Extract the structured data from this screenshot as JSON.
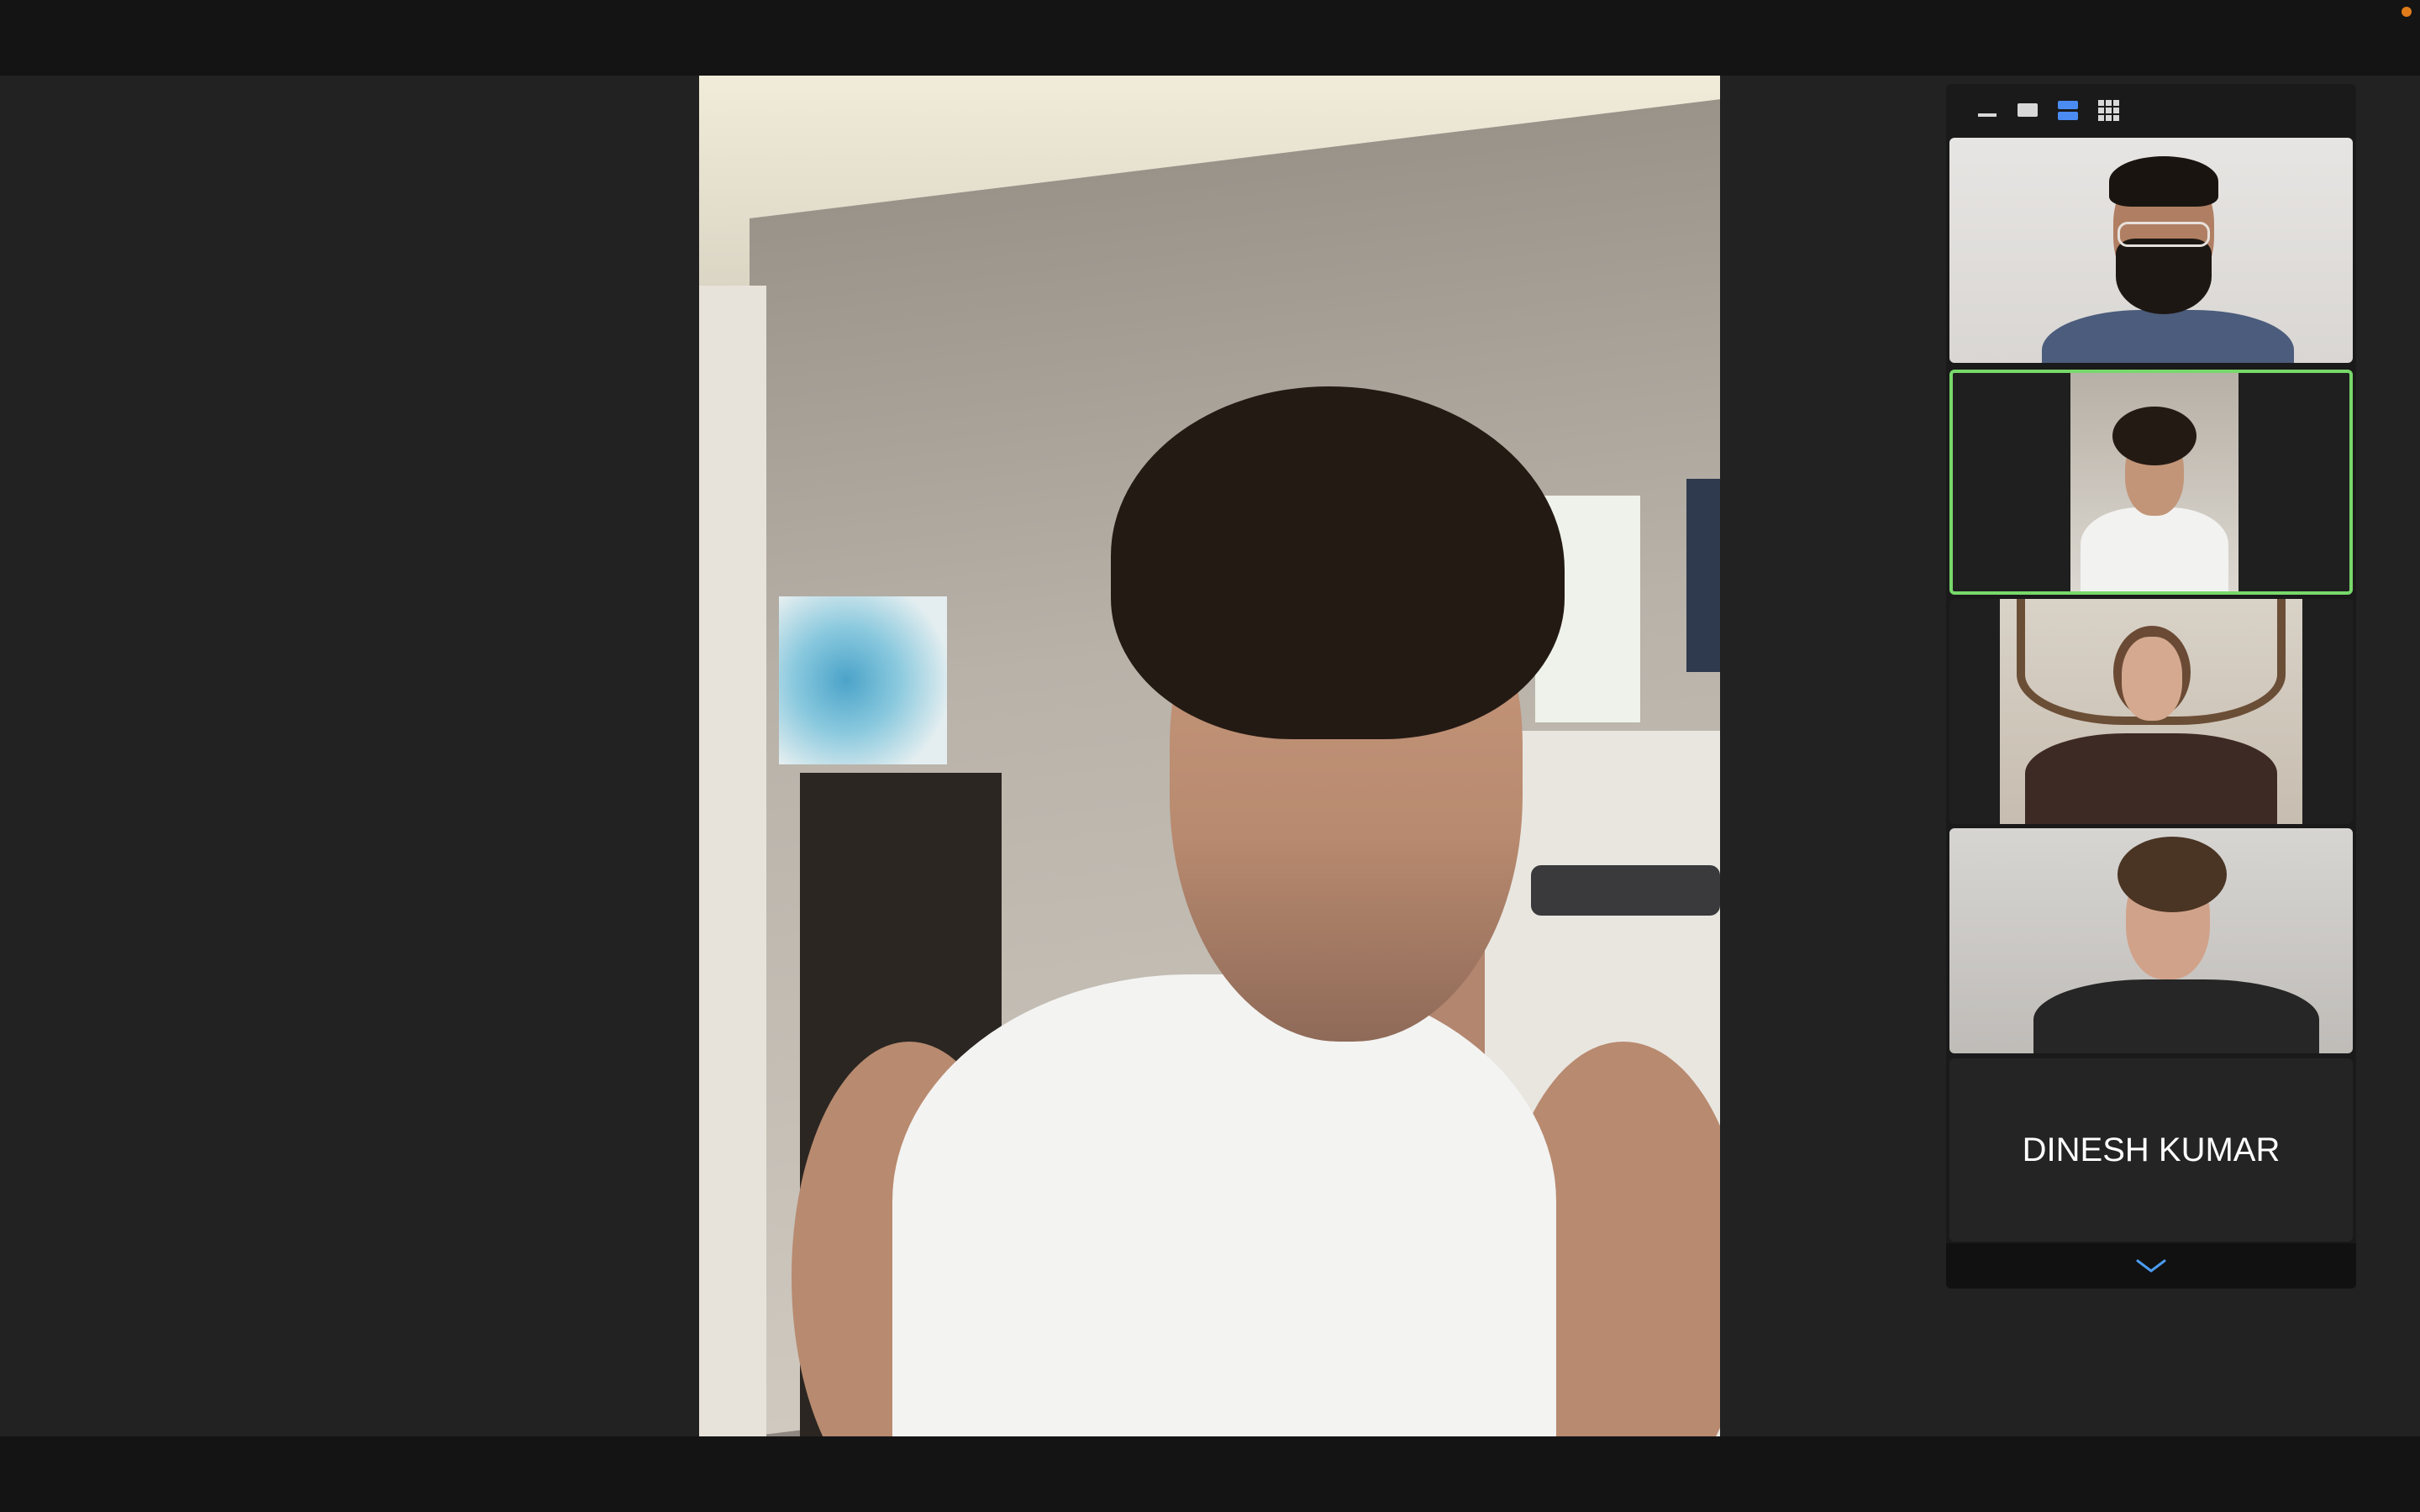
{
  "app": {
    "colors": {
      "background": "#222222",
      "bars": "#141414",
      "active_speaker_border": "#78d86b",
      "active_view_icon": "#4b8cf2",
      "recording_dot": "#e07b1a"
    }
  },
  "view_toolbar": {
    "buttons": [
      {
        "icon": "minimize-view-icon",
        "active": false
      },
      {
        "icon": "speaker-view-icon",
        "active": false
      },
      {
        "icon": "filmstrip-view-icon",
        "active": true
      },
      {
        "icon": "grid-view-icon",
        "active": false
      }
    ]
  },
  "gallery": {
    "participants": [
      {
        "id": "p1",
        "video": true,
        "active_speaker": false
      },
      {
        "id": "p2",
        "video": true,
        "active_speaker": true
      },
      {
        "id": "p3",
        "video": true,
        "active_speaker": false
      },
      {
        "id": "p4",
        "video": true,
        "active_speaker": false
      },
      {
        "id": "p5",
        "video": false,
        "name": "DINESH KUMAR"
      }
    ],
    "scroll_icon": "chevron-down-icon"
  }
}
